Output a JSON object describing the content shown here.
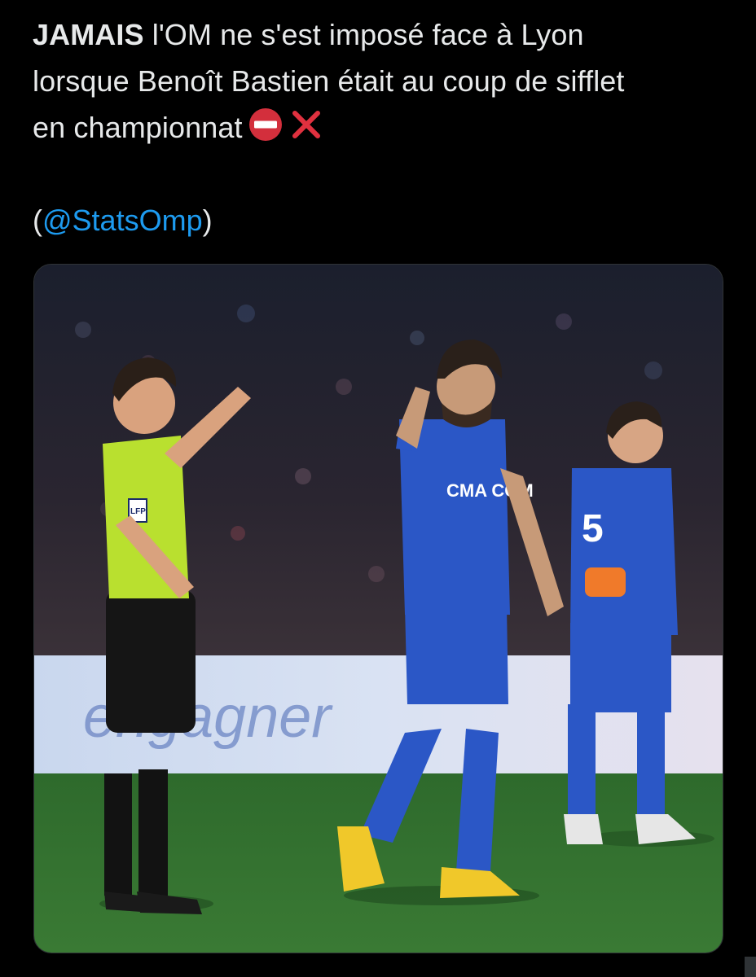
{
  "tweet": {
    "line1_bold": "JAMAIS",
    "line1_rest": " l'OM ne s'est imposé face à Lyon",
    "line2": "lorsque Benoît Bastien était au coup de sifflet",
    "line3": "en championnat",
    "emojis": [
      "no-entry-icon",
      "cross-mark-icon"
    ],
    "credit_open": "(",
    "credit_mention": "@StatsOmp",
    "credit_close": ")"
  },
  "photo": {
    "sponsor_text": "CMA CGM",
    "player_number": "5",
    "referee_badge": "LFP",
    "board_text": "engagner"
  },
  "colors": {
    "background": "#000000",
    "text": "#e7e9ea",
    "mention": "#1d9bf0",
    "om_blue": "#2b57c6",
    "referee_green": "#b9e02f",
    "pitch_green": "#2f6d2e"
  }
}
